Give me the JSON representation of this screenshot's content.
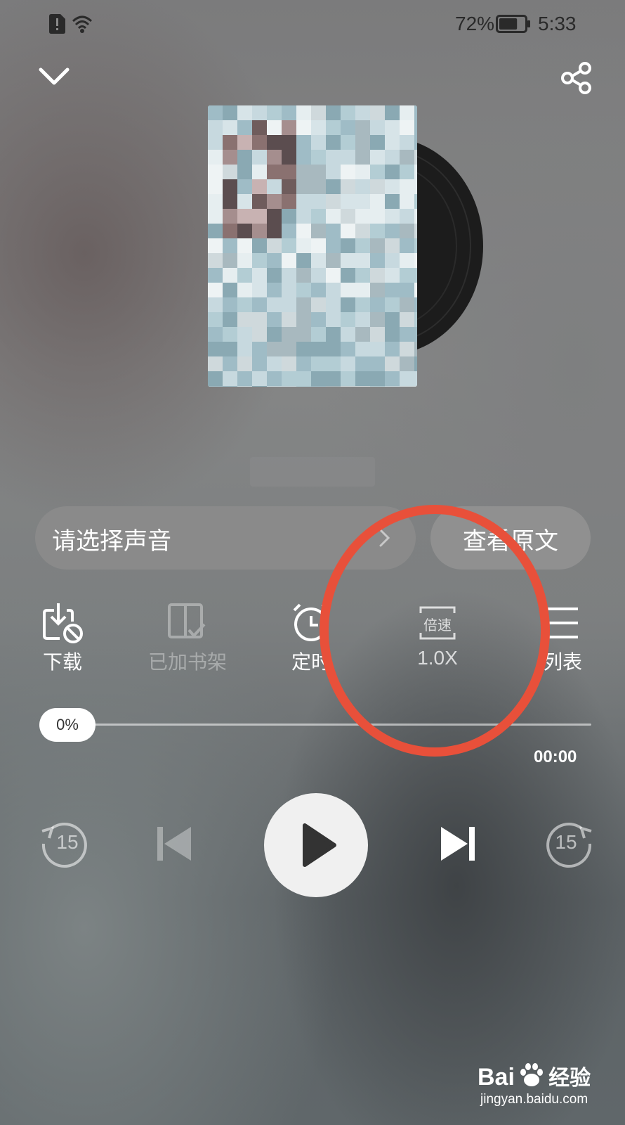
{
  "status_bar": {
    "battery_percent": "72%",
    "battery_level": 0.72,
    "time": "5:33",
    "icons": [
      "sim-alert-icon",
      "wifi-icon",
      "battery-icon"
    ]
  },
  "header": {
    "icons": [
      "chevron-down-icon",
      "share-icon"
    ]
  },
  "album": {
    "cover": "pixelated-album-cover",
    "title": ""
  },
  "voice_selector": {
    "label": "请选择声音"
  },
  "view_text_button": {
    "label": "查看原文"
  },
  "functions": [
    {
      "icon": "download-icon",
      "label": "下载",
      "enabled": true
    },
    {
      "icon": "bookshelf-icon",
      "label": "已加书架",
      "enabled": false
    },
    {
      "icon": "timer-icon",
      "label": "定时",
      "enabled": true
    },
    {
      "icon": "speed-icon",
      "icon_text": "倍速",
      "label": "1.0X",
      "enabled": true
    },
    {
      "icon": "playlist-icon",
      "label": "列表",
      "enabled": true
    }
  ],
  "progress": {
    "percent_label": "0%",
    "value": 0,
    "duration": "00:00"
  },
  "controls": {
    "rewind_seconds": "15",
    "forward_seconds": "15",
    "icons": [
      "rewind-15-icon",
      "previous-icon",
      "play-icon",
      "next-icon",
      "forward-15-icon"
    ]
  },
  "annotation": {
    "type": "red-circle",
    "color": "#e8503a",
    "target": "speed-button"
  },
  "watermark": {
    "brand": "Bai",
    "brand_suffix": "经验",
    "url": "jingyan.baidu.com"
  }
}
